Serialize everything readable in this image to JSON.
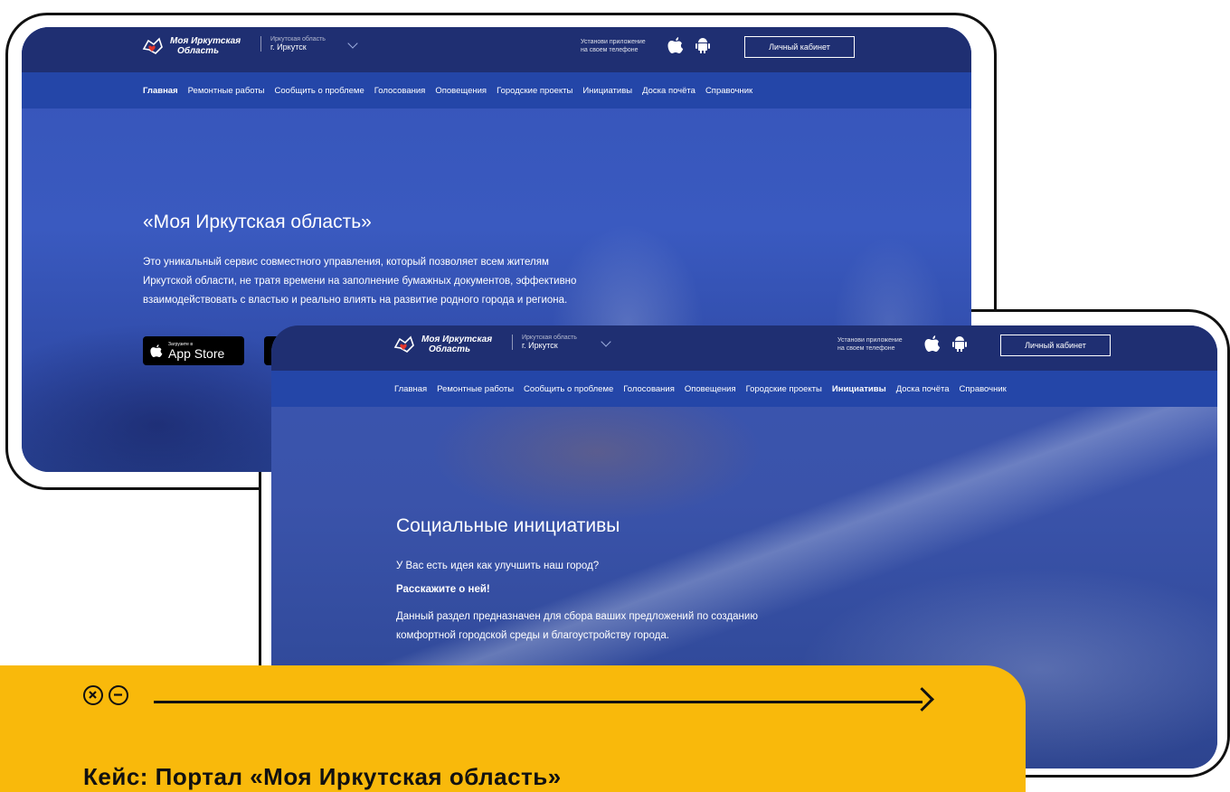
{
  "colors": {
    "accent": "#f9b90b",
    "header": "#1f2f72",
    "nav": "#2446a8",
    "outline": "#111111"
  },
  "back_screen": {
    "logo": {
      "line1": "Моя Иркутская",
      "line2": "Область"
    },
    "region": {
      "label": "Иркутская область",
      "city": "г. Иркутск"
    },
    "install": {
      "line1": "Установи приложение",
      "line2": "на своем телефоне"
    },
    "cabinet_label": "Личный кабинет",
    "nav": [
      "Главная",
      "Ремонтные работы",
      "Сообщить о проблеме",
      "Голосования",
      "Оповещения",
      "Городские проекты",
      "Инициативы",
      "Доска почёта",
      "Справочник"
    ],
    "active_nav": "Главная",
    "hero_title": "«Моя Иркутская область»",
    "hero_text": "Это уникальный сервис совместного управления, который позволяет всем жителям Иркутской области, не тратя времени на заполнение бумажных документов, эффективно взаимодействовать с властью и реально влиять на развитие родного города и региона.",
    "appstore": {
      "small": "Загрузите в",
      "big": "App Store"
    }
  },
  "front_screen": {
    "logo": {
      "line1": "Моя Иркутская",
      "line2": "Область"
    },
    "region": {
      "label": "Иркутская область",
      "city": "г. Иркутск"
    },
    "install": {
      "line1": "Установи приложение",
      "line2": "на своем телефоне"
    },
    "cabinet_label": "Личный кабинет",
    "nav": [
      "Главная",
      "Ремонтные работы",
      "Сообщить о проблеме",
      "Голосования",
      "Оповещения",
      "Городские проекты",
      "Инициативы",
      "Доска почёта",
      "Справочник"
    ],
    "active_nav": "Инициативы",
    "hero_title": "Социальные инициативы",
    "line1": "У Вас есть идея как улучшить наш город?",
    "line2": "Расскажите о ней!",
    "line3": "Данный раздел предназначен для сбора ваших предложений по созданию комфортной городской среды и благоустройству города."
  },
  "card": {
    "icons": [
      "close-circle-icon",
      "minus-circle-icon",
      "arrow-right-icon"
    ],
    "title": "Кейс: Портал «Моя Иркутская область»"
  }
}
